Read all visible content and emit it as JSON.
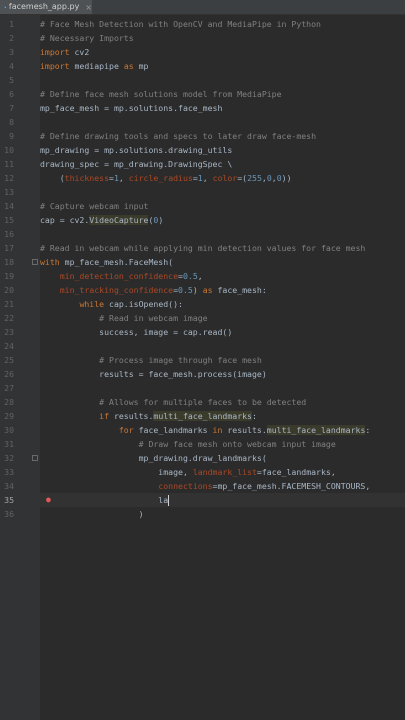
{
  "tab": {
    "filename": "facemesh_app.py",
    "icon": "python-file-icon"
  },
  "colors": {
    "background": "#2b2b2b",
    "comment": "#808080",
    "keyword": "#cc7832",
    "number": "#6897bb",
    "param": "#aa4926",
    "text": "#a9b7c6"
  },
  "current_line": 35,
  "lines": [
    {
      "n": 1,
      "segs": [
        [
          "c-comment",
          "# Face Mesh Detection with OpenCV and MediaPipe in Python"
        ]
      ]
    },
    {
      "n": 2,
      "segs": [
        [
          "c-comment",
          "# Necessary Imports"
        ]
      ]
    },
    {
      "n": 3,
      "segs": [
        [
          "c-kw",
          "import"
        ],
        [
          "",
          " cv2"
        ]
      ]
    },
    {
      "n": 4,
      "segs": [
        [
          "c-kw",
          "import"
        ],
        [
          "",
          " mediapipe "
        ],
        [
          "c-kw",
          "as"
        ],
        [
          "",
          " mp"
        ]
      ]
    },
    {
      "n": 5,
      "segs": []
    },
    {
      "n": 6,
      "segs": [
        [
          "c-comment",
          "# Define face mesh solutions model from MediaPipe"
        ]
      ]
    },
    {
      "n": 7,
      "segs": [
        [
          "",
          "mp_face_mesh = mp.solutions.face_mesh"
        ]
      ]
    },
    {
      "n": 8,
      "segs": []
    },
    {
      "n": 9,
      "segs": [
        [
          "c-comment",
          "# Define drawing tools and specs to later draw face-mesh"
        ]
      ]
    },
    {
      "n": 10,
      "segs": [
        [
          "",
          "mp_drawing = mp.solutions.drawing_utils"
        ]
      ]
    },
    {
      "n": 11,
      "segs": [
        [
          "",
          "drawing_spec = mp_drawing.DrawingSpec \\"
        ]
      ]
    },
    {
      "n": 12,
      "segs": [
        [
          "",
          "    ("
        ],
        [
          "c-param",
          "thickness"
        ],
        [
          "",
          "="
        ],
        [
          "c-num",
          "1"
        ],
        [
          "",
          ", "
        ],
        [
          "c-param",
          "circle_radius"
        ],
        [
          "",
          "="
        ],
        [
          "c-num",
          "1"
        ],
        [
          "",
          ", "
        ],
        [
          "c-param",
          "color"
        ],
        [
          "",
          "=("
        ],
        [
          "c-num",
          "255"
        ],
        [
          "",
          ","
        ],
        [
          "c-num",
          "0"
        ],
        [
          "",
          ","
        ],
        [
          "c-num",
          "0"
        ],
        [
          "",
          "))"
        ]
      ]
    },
    {
      "n": 13,
      "segs": []
    },
    {
      "n": 14,
      "segs": [
        [
          "c-comment",
          "# Capture webcam input"
        ]
      ]
    },
    {
      "n": 15,
      "segs": [
        [
          "",
          "cap = cv2."
        ],
        [
          "c-hl",
          "VideoCapture"
        ],
        [
          "",
          "("
        ],
        [
          "c-num",
          "0"
        ],
        [
          "",
          ")"
        ]
      ]
    },
    {
      "n": 16,
      "segs": []
    },
    {
      "n": 17,
      "segs": [
        [
          "c-comment",
          "# Read in webcam while applying min detection values for face mesh"
        ]
      ]
    },
    {
      "n": 18,
      "segs": [
        [
          "c-kw",
          "with"
        ],
        [
          "",
          " mp_face_mesh.FaceMesh("
        ]
      ]
    },
    {
      "n": 19,
      "segs": [
        [
          "",
          "    "
        ],
        [
          "c-param",
          "min_detection_confidence"
        ],
        [
          "",
          "="
        ],
        [
          "c-num",
          "0.5"
        ],
        [
          "",
          ","
        ]
      ]
    },
    {
      "n": 20,
      "segs": [
        [
          "",
          "    "
        ],
        [
          "c-param",
          "min_tracking_confidence"
        ],
        [
          "",
          "="
        ],
        [
          "c-num",
          "0.5"
        ],
        [
          "",
          ") "
        ],
        [
          "c-kw",
          "as"
        ],
        [
          "",
          " face_mesh:"
        ]
      ]
    },
    {
      "n": 21,
      "segs": [
        [
          "",
          "        "
        ],
        [
          "c-kw",
          "while"
        ],
        [
          "",
          " cap.isOpened():"
        ]
      ]
    },
    {
      "n": 22,
      "segs": [
        [
          "",
          "            "
        ],
        [
          "c-comment",
          "# Read in webcam image"
        ]
      ]
    },
    {
      "n": 23,
      "segs": [
        [
          "",
          "            success, image = cap.read()"
        ]
      ]
    },
    {
      "n": 24,
      "segs": []
    },
    {
      "n": 25,
      "segs": [
        [
          "",
          "            "
        ],
        [
          "c-comment",
          "# Process image through face mesh"
        ]
      ]
    },
    {
      "n": 26,
      "segs": [
        [
          "",
          "            results = face_mesh.process(image)"
        ]
      ]
    },
    {
      "n": 27,
      "segs": []
    },
    {
      "n": 28,
      "segs": [
        [
          "",
          "            "
        ],
        [
          "c-comment",
          "# Allows for multiple faces to be detected"
        ]
      ]
    },
    {
      "n": 29,
      "segs": [
        [
          "",
          "            "
        ],
        [
          "c-kw",
          "if"
        ],
        [
          "",
          " results."
        ],
        [
          "c-hl",
          "multi_face_landmarks"
        ],
        [
          "",
          ":"
        ]
      ]
    },
    {
      "n": 30,
      "segs": [
        [
          "",
          "                "
        ],
        [
          "c-kw",
          "for"
        ],
        [
          "",
          " face_landmarks "
        ],
        [
          "c-kw",
          "in"
        ],
        [
          "",
          " results."
        ],
        [
          "c-hl",
          "multi_face_landmarks"
        ],
        [
          "",
          ":"
        ]
      ]
    },
    {
      "n": 31,
      "segs": [
        [
          "",
          "                    "
        ],
        [
          "c-comment",
          "# Draw face mesh onto webcam input image"
        ]
      ]
    },
    {
      "n": 32,
      "segs": [
        [
          "",
          "                    mp_drawing.draw_landmarks("
        ]
      ]
    },
    {
      "n": 33,
      "segs": [
        [
          "",
          "                        image, "
        ],
        [
          "c-param",
          "landmark_list"
        ],
        [
          "",
          "=face_landmarks,"
        ]
      ]
    },
    {
      "n": 34,
      "segs": [
        [
          "",
          "                        "
        ],
        [
          "c-param",
          "connections"
        ],
        [
          "",
          "=mp_face_mesh.FACEMESH_CONTOURS,"
        ]
      ]
    },
    {
      "n": 35,
      "segs": [
        [
          "",
          "                        la"
        ]
      ]
    },
    {
      "n": 36,
      "segs": [
        [
          "",
          "                    )"
        ]
      ]
    }
  ]
}
